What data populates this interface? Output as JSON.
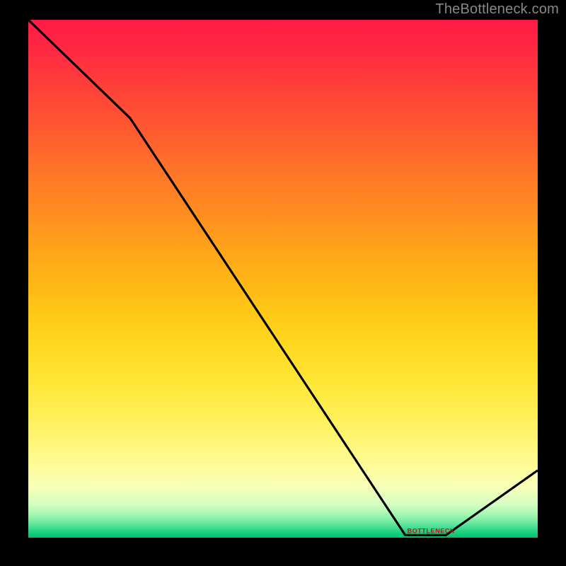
{
  "watermark": "TheBottleneck.com",
  "bottom_label": "BOTTLENECK",
  "chart_data": {
    "type": "line",
    "title": "",
    "xlabel": "",
    "ylabel": "",
    "xlim": [
      0,
      100
    ],
    "ylim": [
      0,
      100
    ],
    "x": [
      0,
      20,
      74,
      82,
      100
    ],
    "values": [
      100,
      81,
      0.5,
      0.5,
      13
    ],
    "background_gradient": {
      "direction": "vertical",
      "description": "red at top through orange, yellow, near-white, to green at bottom"
    },
    "notes": "Black curve descends from top-left, changes slope around x≈20, reaches near-zero around x≈74–82, then rises to ~13 at x=100. Small red text sits on the flat valley segment near the bottom."
  }
}
